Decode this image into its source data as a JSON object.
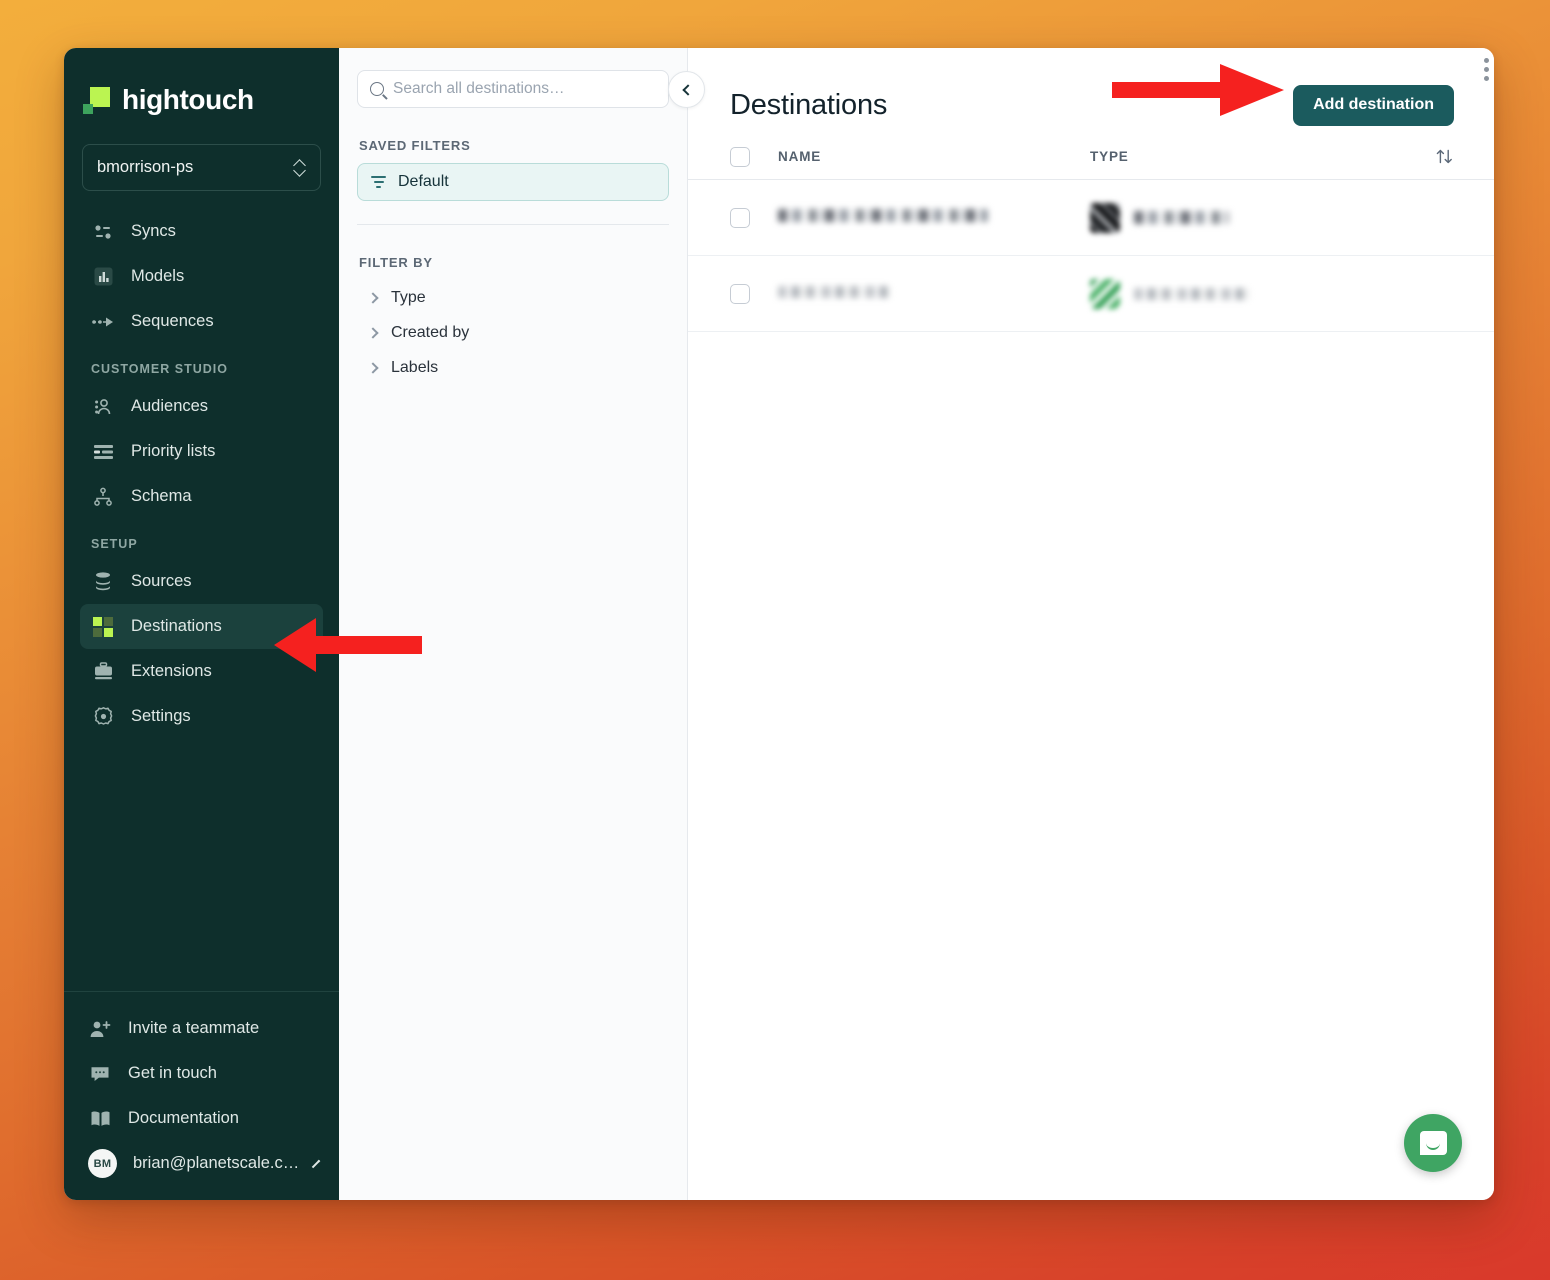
{
  "brand": {
    "name": "hightouch",
    "logo_colors": {
      "primary": "#bbf451",
      "secondary": "#3da35d"
    },
    "sidebar_bg": "#0e2f2c",
    "accent_teal": "#1b5b5e"
  },
  "sidebar": {
    "workspace": {
      "name": "bmorrison-ps",
      "icon": "chevron-updown-icon"
    },
    "primary_items": [
      {
        "label": "Syncs",
        "icon": "syncs-icon",
        "active": false
      },
      {
        "label": "Models",
        "icon": "models-icon",
        "active": false
      },
      {
        "label": "Sequences",
        "icon": "sequences-icon",
        "active": false
      }
    ],
    "sections": [
      {
        "label": "CUSTOMER STUDIO",
        "items": [
          {
            "label": "Audiences",
            "icon": "audiences-icon",
            "active": false
          },
          {
            "label": "Priority lists",
            "icon": "priority-lists-icon",
            "active": false
          },
          {
            "label": "Schema",
            "icon": "schema-icon",
            "active": false
          }
        ]
      },
      {
        "label": "SETUP",
        "items": [
          {
            "label": "Sources",
            "icon": "sources-icon",
            "active": false
          },
          {
            "label": "Destinations",
            "icon": "destinations-icon",
            "active": true
          },
          {
            "label": "Extensions",
            "icon": "extensions-icon",
            "active": false
          },
          {
            "label": "Settings",
            "icon": "settings-gear-icon",
            "active": false
          }
        ]
      }
    ],
    "footer": [
      {
        "label": "Invite a teammate",
        "icon": "user-plus-icon"
      },
      {
        "label": "Get in touch",
        "icon": "chat-icon"
      },
      {
        "label": "Documentation",
        "icon": "book-icon"
      }
    ],
    "account": {
      "initials": "BM",
      "email": "brian@planetscale.c…",
      "icon": "chevron-right-icon"
    }
  },
  "filter_panel": {
    "search": {
      "placeholder": "Search all destinations…",
      "value": "",
      "icon": "search-icon"
    },
    "saved_filters_label": "SAVED FILTERS",
    "saved_filters": [
      {
        "label": "Default",
        "icon": "filter-icon",
        "selected": true
      }
    ],
    "filter_by_label": "FILTER BY",
    "filter_groups": [
      {
        "label": "Type",
        "icon": "chevron-right-icon",
        "expanded": false
      },
      {
        "label": "Created by",
        "icon": "chevron-right-icon",
        "expanded": false
      },
      {
        "label": "Labels",
        "icon": "chevron-right-icon",
        "expanded": false
      }
    ],
    "collapse_button": {
      "icon": "chevron-left-icon"
    }
  },
  "main": {
    "title": "Destinations",
    "add_button": {
      "label": "Add destination"
    },
    "table": {
      "columns": [
        "NAME",
        "TYPE"
      ],
      "sort_icon": "sort-updown-icon",
      "select_all_checkbox": false,
      "rows": [
        {
          "name": "",
          "name_redacted": true,
          "type": "",
          "type_redacted": true,
          "type_logo": "dark-logo",
          "selected": false
        },
        {
          "name": "",
          "name_redacted": true,
          "type": "",
          "type_redacted": true,
          "type_logo": "green-logo",
          "selected": false
        }
      ]
    }
  },
  "widgets": {
    "intercom_launcher": {
      "icon": "chat-bubble-icon",
      "color": "#3fa563"
    },
    "drag_handle": {
      "icon": "drag-dots-icon"
    }
  },
  "annotations": [
    {
      "name": "arrow-to-add-destination",
      "color": "#f5211f",
      "points_to": "Add destination"
    },
    {
      "name": "arrow-to-destinations-nav",
      "color": "#f5211f",
      "points_to": "Destinations"
    }
  ]
}
